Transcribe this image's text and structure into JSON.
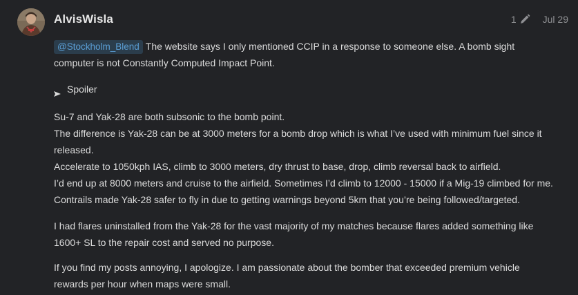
{
  "post": {
    "author": "AlvisWisla",
    "edit_count": "1",
    "date": "Jul 29",
    "icons": {
      "edit": "pencil-icon",
      "spoiler": "triangle-right-icon"
    },
    "mention": "@Stockholm_Blend",
    "para1": {
      "line1": "The website says I only mentioned CCIP in a response to someone else. A bomb sight",
      "line2": "computer is not Constantly Computed Impact Point."
    },
    "spoiler_label": "Spoiler",
    "para2": {
      "line1": "Su-7 and Yak-28 are both subsonic to the bomb point.",
      "line2": "The difference is Yak-28 can be at 3000 meters for a bomb drop which is what I’ve used with minimum fuel since it",
      "line3": "released.",
      "line4": "Accelerate to 1050kph IAS, climb to 3000 meters, dry thrust to base, drop, climb reversal back to airfield.",
      "line5": "I’d end up at 8000 meters and cruise to the airfield. Sometimes I’d climb to 12000 - 15000 if a Mig-19 climbed for me.",
      "line6": "Contrails made Yak-28 safer to fly in due to getting warnings beyond 5km that you’re being followed/targeted."
    },
    "para3": {
      "line1": "I had flares uninstalled from the Yak-28 for the vast majority of my matches because flares added something like",
      "line2": "1600+ SL to the repair cost and served no purpose."
    },
    "para4": {
      "line1": "If you find my posts annoying, I apologize. I am passionate about the bomber that exceeded premium vehicle",
      "line2": "rewards per hour when maps were small."
    }
  },
  "colors": {
    "background": "#222326",
    "text": "#dcdcdc",
    "mention_bg": "#2b3d4c",
    "mention_text": "#5b9fd6",
    "meta_text": "#8f9093"
  }
}
